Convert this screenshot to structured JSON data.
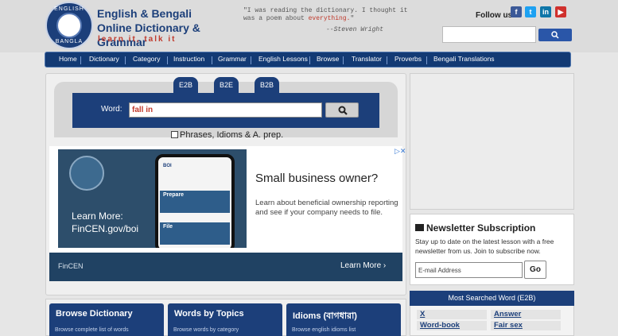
{
  "header": {
    "logo_top": "ENGLISH",
    "logo_bottom": "BANGLA",
    "title": "English & Bengali Online Dictionary & Grammar",
    "tagline": "learn it, talk it",
    "quote_pre": "\"I was reading the dictionary. I thought it was a poem about ",
    "quote_highlight": "everything.",
    "quote_post": "\"",
    "quote_author": "--Steven Wright",
    "follow_label": "Follow us:",
    "social": [
      {
        "name": "facebook-icon",
        "glyph": "f",
        "color": "#3b5998"
      },
      {
        "name": "twitter-icon",
        "glyph": "t",
        "color": "#1da1f2"
      },
      {
        "name": "linkedin-icon",
        "glyph": "in",
        "color": "#0e76a8"
      },
      {
        "name": "youtube-icon",
        "glyph": "▶",
        "color": "#d0312d"
      }
    ]
  },
  "nav": {
    "items": [
      "Home",
      "Dictionary",
      "Category",
      "Instruction",
      "Grammar",
      "English Lessons",
      "Browse",
      "Translator",
      "Proverbs",
      "Bengali Translations"
    ]
  },
  "search": {
    "tabs": [
      "E2B",
      "B2E",
      "B2B"
    ],
    "word_label": "Word:",
    "word_value": "fall in",
    "checkbox_label": "Phrases, Idioms & A. prep."
  },
  "ad": {
    "learn_more_line1": "Learn More:",
    "learn_more_line2": "FinCEN.gov/boi",
    "phone_header": "BOI",
    "phone_band1": "Prepare",
    "phone_band2": "File",
    "headline": "Small business owner?",
    "body": "Learn about beneficial ownership reporting and see if your company needs to file.",
    "brand": "FinCEN",
    "cta": "Learn More"
  },
  "newsletter": {
    "title": "Newsletter Subscription",
    "text": "Stay up to date on the latest lesson with a free newsletter from us. Join to subscribe now.",
    "placeholder": "E-mail Address",
    "button": "Go"
  },
  "most_searched": {
    "title": "Most Searched Word (E2B)",
    "words": [
      "X",
      "Answer",
      "Word-book",
      "Fair sex"
    ]
  },
  "cards": [
    {
      "title": "Browse Dictionary",
      "subtitle": "Browse complete list of words"
    },
    {
      "title": "Words by Topics",
      "subtitle": "Browse words by category"
    },
    {
      "title": "Idioms (বাগধারা)",
      "subtitle": "Browse english idioms list"
    }
  ]
}
